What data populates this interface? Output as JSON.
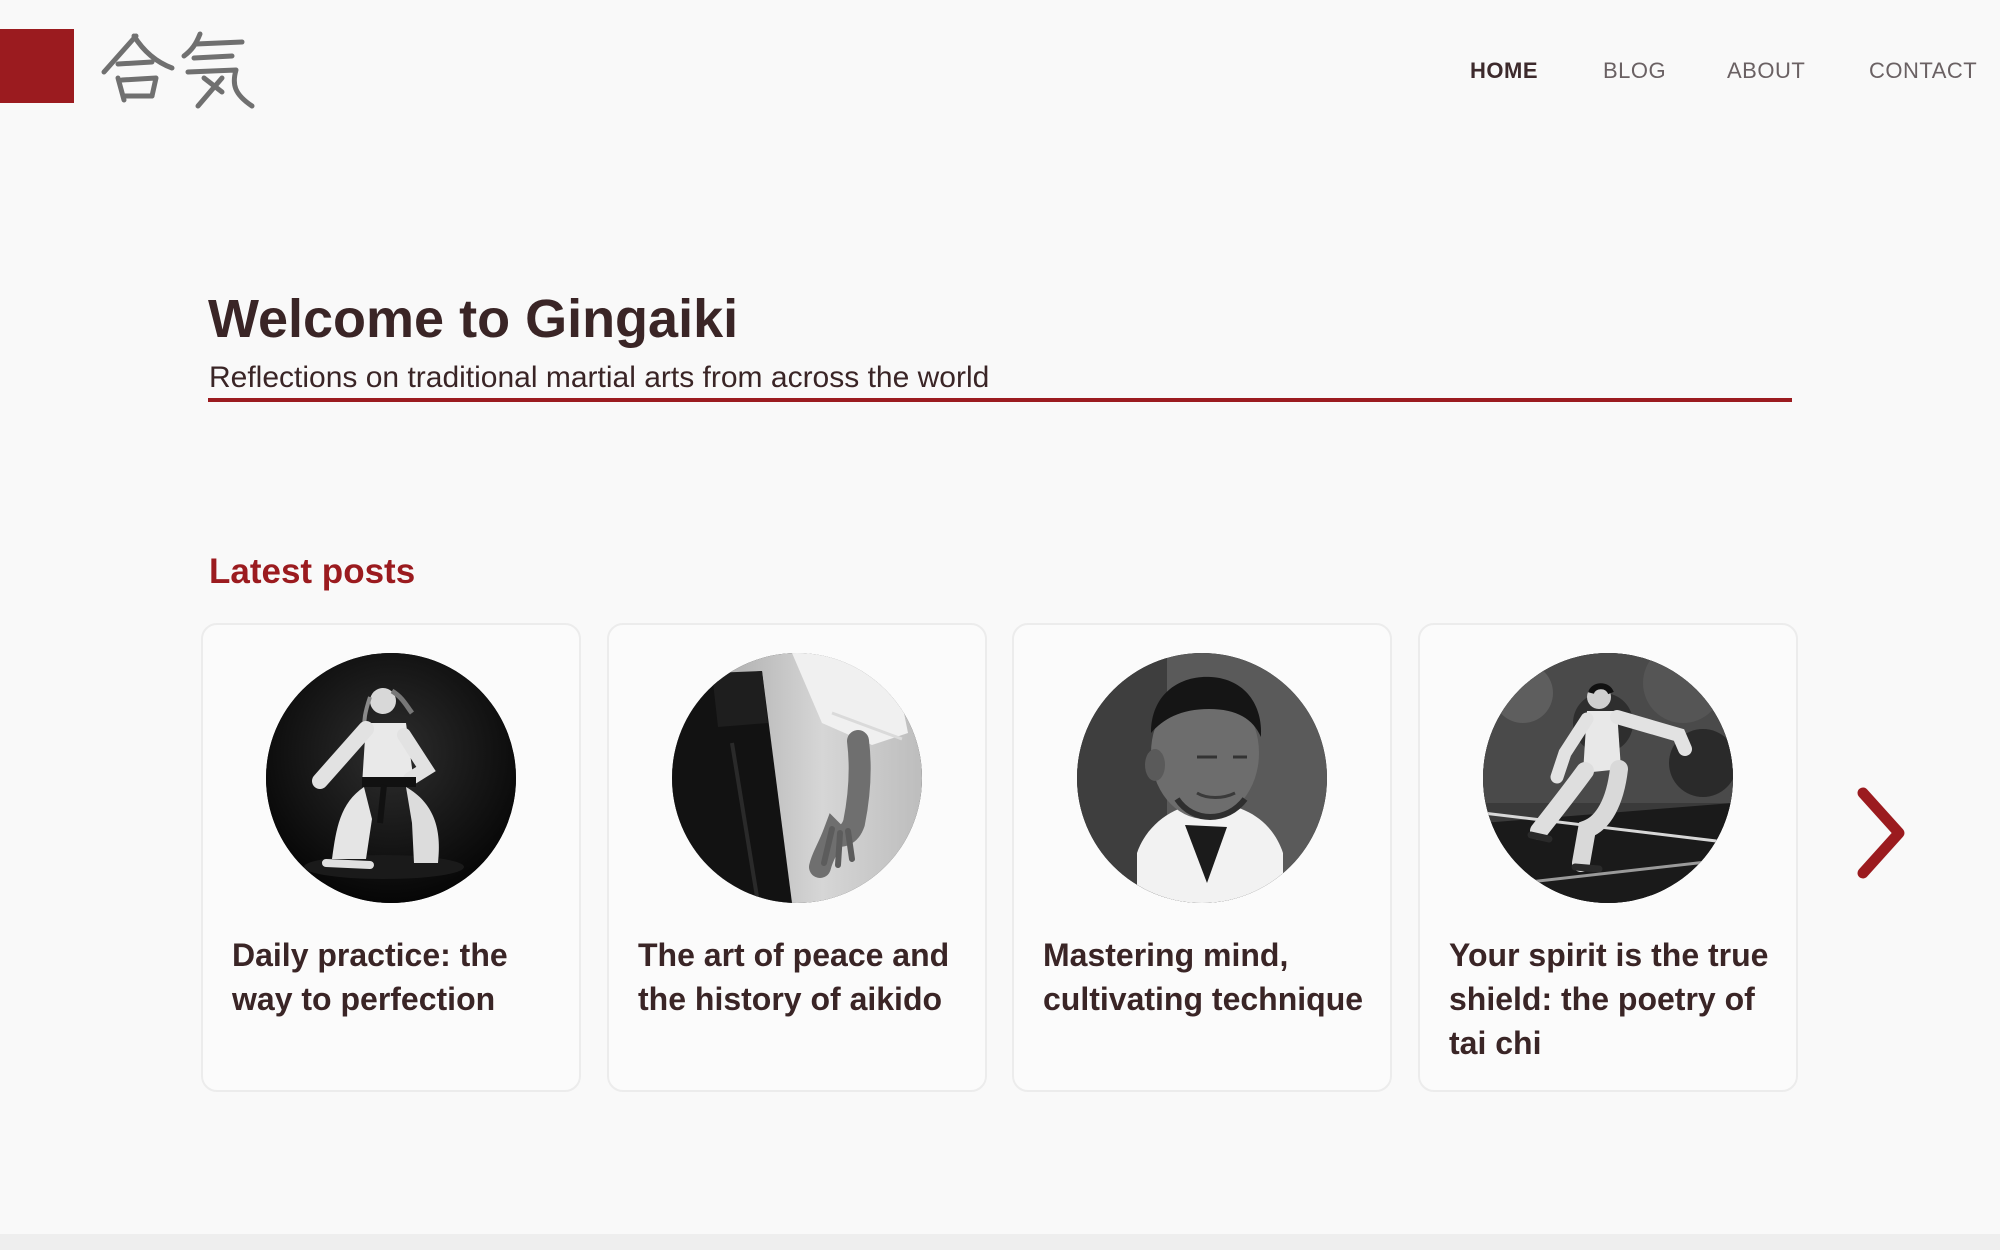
{
  "brand": {
    "logo_text": "合気",
    "accent_color": "#9b1b1f"
  },
  "nav": {
    "items": [
      {
        "label": "HOME",
        "active": true
      },
      {
        "label": "BLOG",
        "active": false
      },
      {
        "label": "ABOUT",
        "active": false
      },
      {
        "label": "CONTACT",
        "active": false
      }
    ]
  },
  "hero": {
    "title": "Welcome to Gingaiki",
    "subtitle": "Reflections on traditional martial arts from across the world"
  },
  "latest": {
    "heading": "Latest posts",
    "posts": [
      {
        "title": "Daily practice: the way to perfection",
        "image": "karate-kneeling-girl-photo"
      },
      {
        "title": "The art of peace and the history of aikido",
        "image": "aikido-hakama-photo"
      },
      {
        "title": "Mastering mind, cultivating technique",
        "image": "meditating-man-photo"
      },
      {
        "title": "Your spirit is the true shield: the poetry of tai chi",
        "image": "tai-chi-stance-photo"
      }
    ],
    "next_icon": "chevron-right-icon"
  }
}
